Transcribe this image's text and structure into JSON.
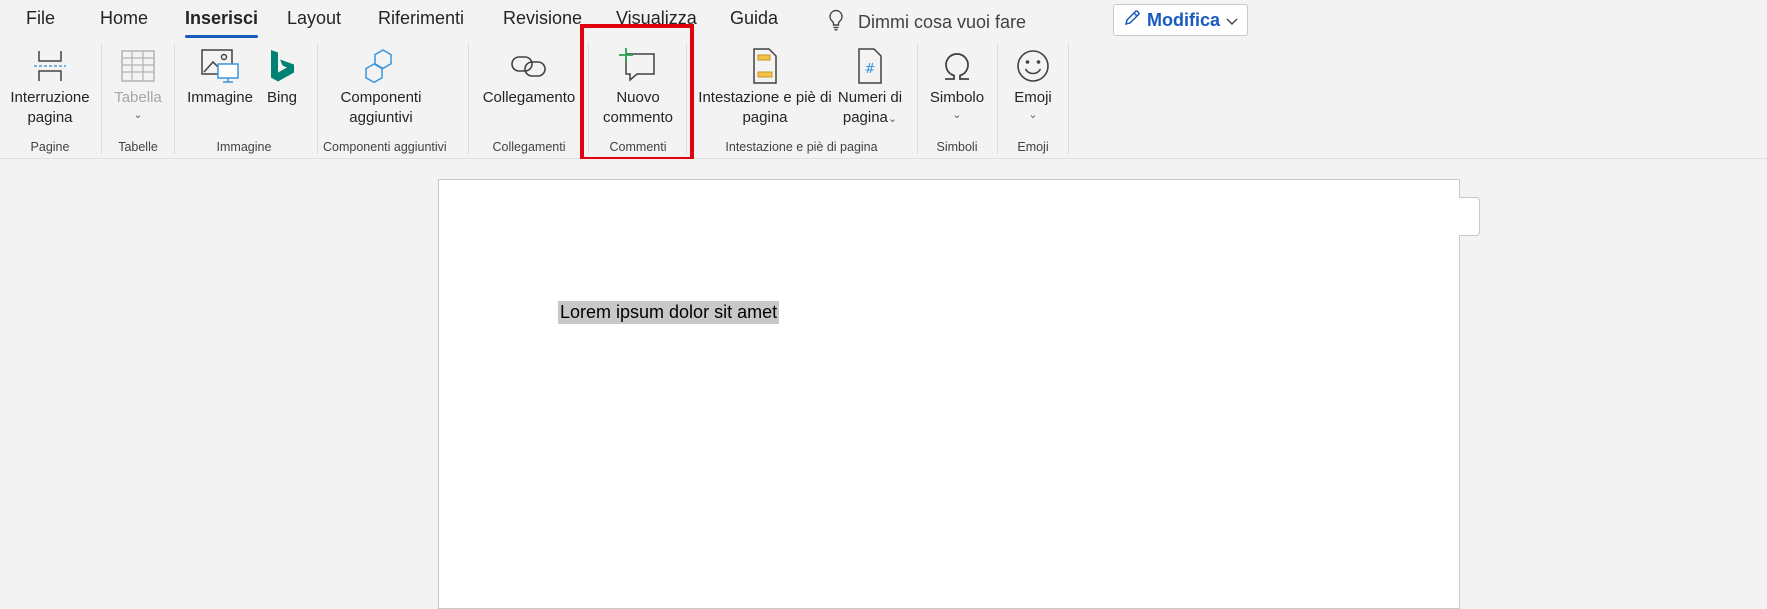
{
  "tabs": [
    "File",
    "Home",
    "Inserisci",
    "Layout",
    "Riferimenti",
    "Revisione",
    "Visualizza",
    "Guida"
  ],
  "active_tab": "Inserisci",
  "tell_me": {
    "text": "Dimmi cosa vuoi fare",
    "icon": "lightbulb-icon"
  },
  "mode_button": {
    "label": "Modifica",
    "icon": "pencil-icon"
  },
  "ribbon": {
    "buttons": {
      "page_break": {
        "line1": "Interruzione",
        "line2": "pagina",
        "icon": "page-break-icon"
      },
      "table": {
        "label": "Tabella",
        "caret": "⌄",
        "icon": "table-icon"
      },
      "image": {
        "label": "Immagine",
        "icon": "image-icon"
      },
      "bing": {
        "label": "Bing",
        "icon": "bing-icon"
      },
      "addins": {
        "line1": "Componenti",
        "line2": "aggiuntivi",
        "icon": "addins-icon"
      },
      "link": {
        "label": "Collegamento",
        "icon": "link-icon"
      },
      "new_comment": {
        "line1": "Nuovo",
        "line2": "commento",
        "icon": "new-comment-icon"
      },
      "header_footer": {
        "line1": "Intestazione e piè di",
        "line2": "pagina",
        "icon": "header-footer-icon"
      },
      "page_numbers": {
        "line1": "Numeri di",
        "line2": "pagina",
        "caret": "⌄",
        "icon": "page-number-icon"
      },
      "symbol": {
        "label": "Simbolo",
        "caret": "⌄",
        "icon": "omega-icon"
      },
      "emoji": {
        "label": "Emoji",
        "caret": "⌄",
        "icon": "smiley-icon"
      }
    },
    "groups": {
      "pages": "Pagine",
      "tables": "Tabelle",
      "image": "Immagine",
      "addins": "Componenti aggiuntivi",
      "links": "Collegamenti",
      "comments": "Commenti",
      "header_footer": "Intestazione e piè di pagina",
      "symbols": "Simboli",
      "emoji": "Emoji"
    }
  },
  "document": {
    "text": "Lorem ipsum dolor sit amet"
  },
  "colors": {
    "accent": "#185abd",
    "highlight": "#e0000e",
    "selection": "#c8c8c8"
  }
}
